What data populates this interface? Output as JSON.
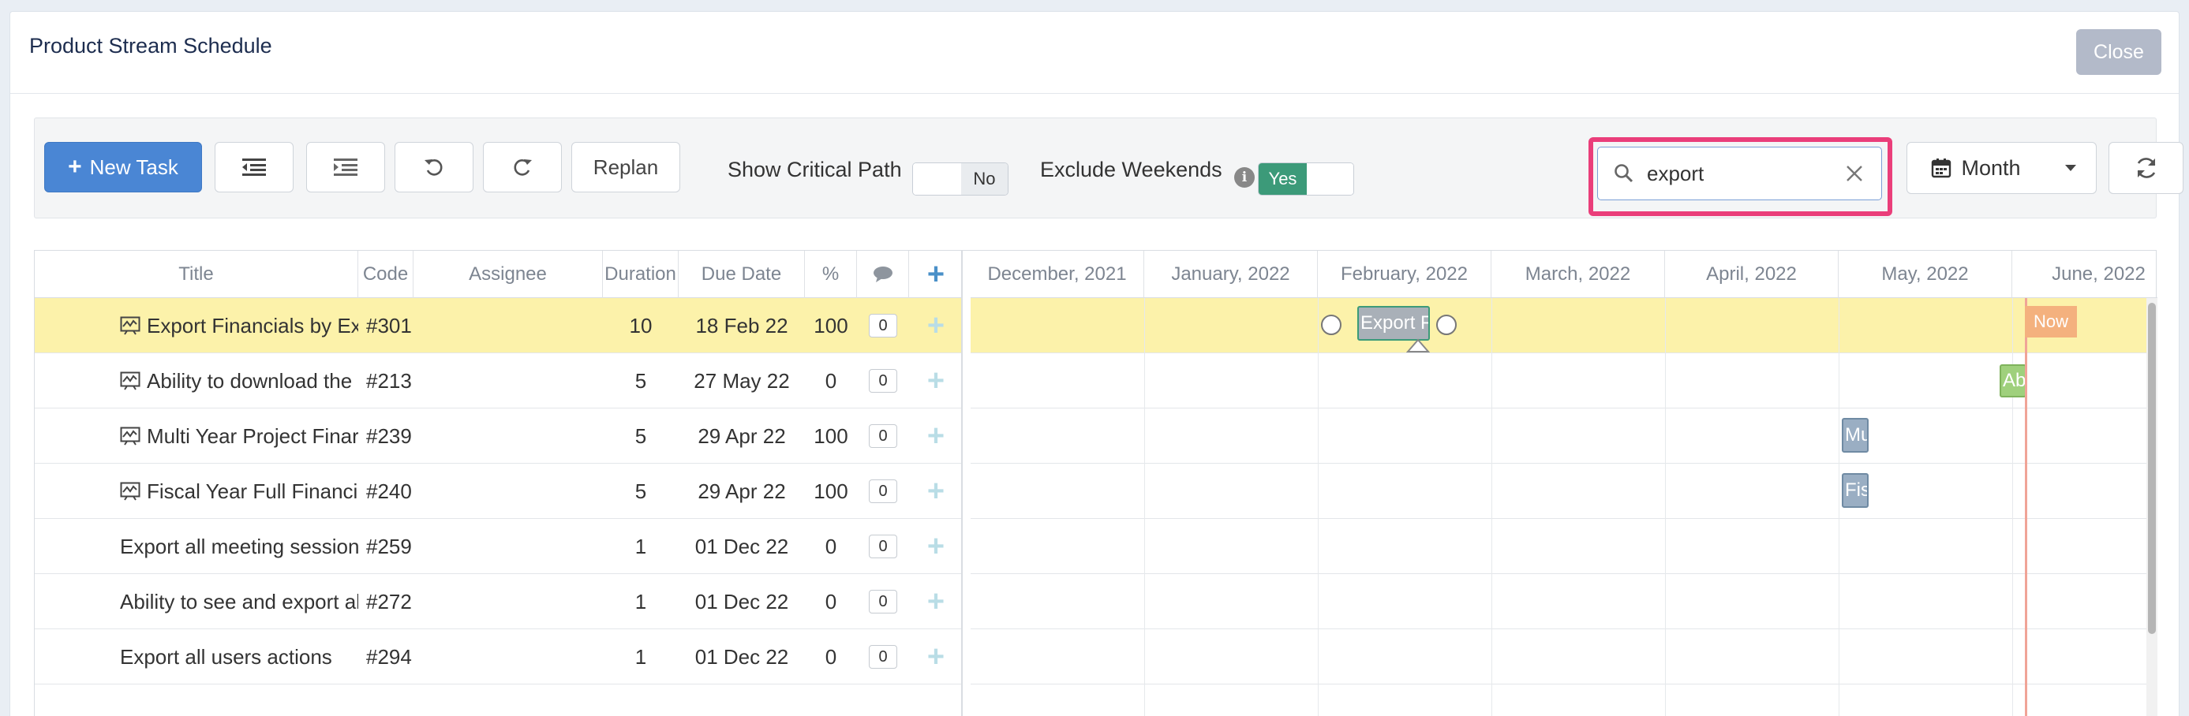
{
  "modal": {
    "title": "Product Stream Schedule",
    "close_label": "Close"
  },
  "toolbar": {
    "new_task_label": "New Task",
    "replan_label": "Replan",
    "critical_path_label": "Show Critical Path",
    "critical_path_value": "No",
    "exclude_weekends_label": "Exclude Weekends",
    "exclude_weekends_value": "Yes",
    "search_value": "export",
    "view_mode": "Month"
  },
  "columns": {
    "title": "Title",
    "code": "Code",
    "assignee": "Assignee",
    "duration": "Duration",
    "due_date": "Due Date",
    "percent": "%"
  },
  "tasks": [
    {
      "title": "Export Financials by Ex",
      "code": "#301",
      "assignee": "",
      "duration": "10",
      "due": "18 Feb 22",
      "percent": "100",
      "comments": "0",
      "milestone": true,
      "selected": true
    },
    {
      "title": "Ability to download the",
      "code": "#213",
      "assignee": "",
      "duration": "5",
      "due": "27 May 22",
      "percent": "0",
      "comments": "0",
      "milestone": true,
      "selected": false
    },
    {
      "title": "Multi Year Project Finar",
      "code": "#239",
      "assignee": "",
      "duration": "5",
      "due": "29 Apr 22",
      "percent": "100",
      "comments": "0",
      "milestone": true,
      "selected": false
    },
    {
      "title": "Fiscal Year Full Financi",
      "code": "#240",
      "assignee": "",
      "duration": "5",
      "due": "29 Apr 22",
      "percent": "100",
      "comments": "0",
      "milestone": true,
      "selected": false
    },
    {
      "title": "Export all meeting session",
      "code": "#259",
      "assignee": "",
      "duration": "1",
      "due": "01 Dec 22",
      "percent": "0",
      "comments": "0",
      "milestone": false,
      "selected": false
    },
    {
      "title": "Ability to see and export al",
      "code": "#272",
      "assignee": "",
      "duration": "1",
      "due": "01 Dec 22",
      "percent": "0",
      "comments": "0",
      "milestone": false,
      "selected": false
    },
    {
      "title": "Export all users actions",
      "code": "#294",
      "assignee": "",
      "duration": "1",
      "due": "01 Dec 22",
      "percent": "0",
      "comments": "0",
      "milestone": false,
      "selected": false
    }
  ],
  "timeline": {
    "months": [
      "December, 2021",
      "January, 2022",
      "February, 2022",
      "March, 2022",
      "April, 2022",
      "May, 2022",
      "June, 2022"
    ],
    "now_label": "Now",
    "bars": [
      {
        "row": 0,
        "label": "Export F",
        "color": "#a9b0b8"
      },
      {
        "row": 1,
        "label": "Ab",
        "color": "#9fd07c"
      },
      {
        "row": 2,
        "label": "Mu",
        "color": "#9aaec3"
      },
      {
        "row": 3,
        "label": "Fis",
        "color": "#9aaec3"
      }
    ]
  },
  "colors": {
    "primary": "#4a86d4",
    "highlight": "#ea3e7a",
    "selected_row": "#fcf2aa",
    "toggle_on": "#3c9a79",
    "now": "#f4b17e"
  }
}
